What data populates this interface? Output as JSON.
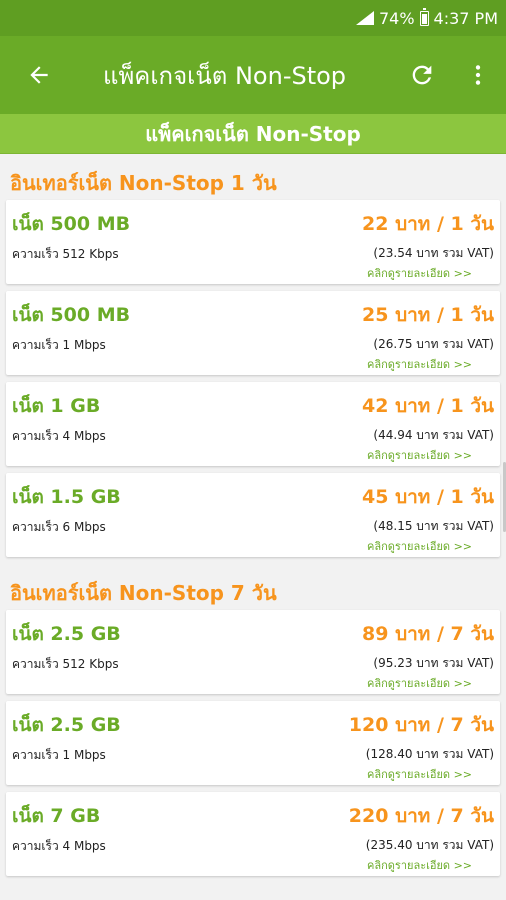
{
  "status_bar": {
    "battery": "74%",
    "time": "4:37 PM"
  },
  "app_bar": {
    "title": "แพ็คเกจเน็ต Non-Stop"
  },
  "sub_header": {
    "title": "แพ็คเกจเน็ต Non-Stop"
  },
  "sections": [
    {
      "title": "อินเทอร์เน็ต Non-Stop 1 วัน",
      "packages": [
        {
          "name": "เน็ต 500 MB",
          "speed": "ความเร็ว 512 Kbps",
          "price": "22 บาท / 1 วัน",
          "vat": "(23.54 บาท รวม VAT)",
          "link": "คลิกดูรายละเอียด >>"
        },
        {
          "name": "เน็ต 500 MB",
          "speed": "ความเร็ว 1 Mbps",
          "price": "25 บาท / 1 วัน",
          "vat": "(26.75 บาท รวม VAT)",
          "link": "คลิกดูรายละเอียด >>"
        },
        {
          "name": "เน็ต 1 GB",
          "speed": "ความเร็ว 4 Mbps",
          "price": "42 บาท / 1 วัน",
          "vat": "(44.94 บาท รวม VAT)",
          "link": "คลิกดูรายละเอียด >>"
        },
        {
          "name": "เน็ต 1.5 GB",
          "speed": "ความเร็ว 6 Mbps",
          "price": "45 บาท / 1 วัน",
          "vat": "(48.15 บาท รวม VAT)",
          "link": "คลิกดูรายละเอียด >>"
        }
      ]
    },
    {
      "title": "อินเทอร์เน็ต Non-Stop 7 วัน",
      "packages": [
        {
          "name": "เน็ต 2.5 GB",
          "speed": "ความเร็ว 512 Kbps",
          "price": "89 บาท / 7 วัน",
          "vat": "(95.23 บาท รวม VAT)",
          "link": "คลิกดูรายละเอียด >>"
        },
        {
          "name": "เน็ต 2.5 GB",
          "speed": "ความเร็ว 1 Mbps",
          "price": "120 บาท / 7 วัน",
          "vat": "(128.40 บาท รวม VAT)",
          "link": "คลิกดูรายละเอียด >>"
        },
        {
          "name": "เน็ต 7 GB",
          "speed": "ความเร็ว 4 Mbps",
          "price": "220 บาท / 7 วัน",
          "vat": "(235.40 บาท รวม VAT)",
          "link": "คลิกดูรายละเอียด >>"
        }
      ]
    }
  ],
  "colors": {
    "status_bar": "#5f9e22",
    "app_bar": "#6aab27",
    "sub_header": "#8cc63f",
    "accent_orange": "#f7941d",
    "accent_green": "#6aab27"
  },
  "icons": {
    "back": "arrow-left-icon",
    "refresh": "refresh-icon",
    "more": "more-vert-icon",
    "signal": "signal-icon",
    "battery": "battery-icon"
  }
}
